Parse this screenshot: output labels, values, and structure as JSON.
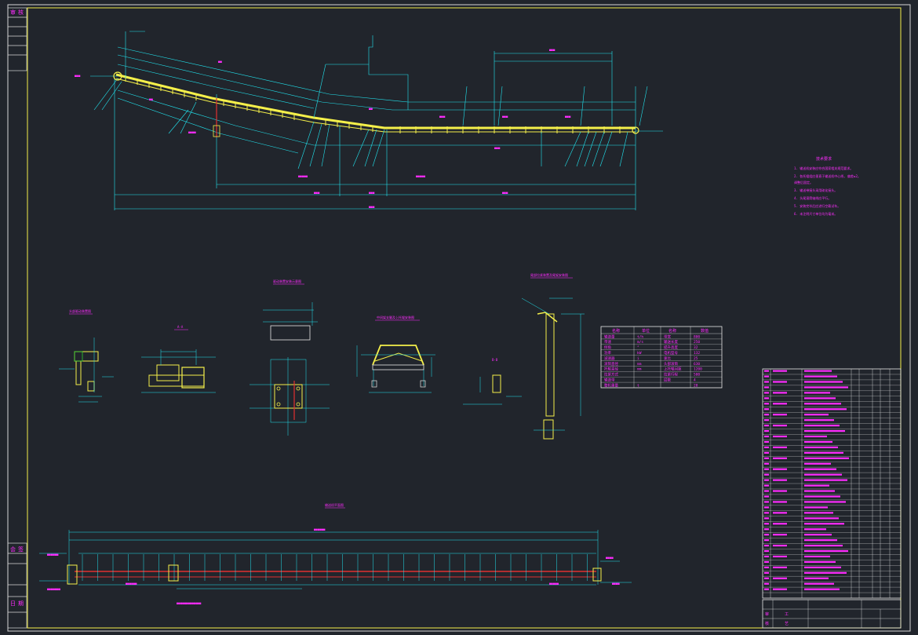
{
  "drawing": {
    "background": "#21252c",
    "colors": {
      "frame": "#f5f04a",
      "dimension": "#22e5f0",
      "label": "#ff2cff",
      "belt": "#f5f04a",
      "idler_line": "#e03030",
      "border": "#d8d8d8"
    },
    "title_block": {
      "left_top_chars": [
        "审",
        "核"
      ],
      "left_bottom_chars": [
        "会",
        "签"
      ],
      "left_footer_chars": [
        "日",
        "期"
      ],
      "bottom_right_chars": [
        "审",
        "核",
        "工",
        "艺"
      ]
    },
    "views": [
      {
        "label": "输送机布置图"
      },
      {
        "label": "头部驱动装置图"
      },
      {
        "label": "A-A"
      },
      {
        "label": "驱动装置安装示意图"
      },
      {
        "label": "中间架支腿及上托辊安装图"
      },
      {
        "label": "B-B"
      },
      {
        "label": "尾部拉紧装置及尾架安装图"
      },
      {
        "label": "输送机平面图"
      }
    ],
    "notes": {
      "heading": "技术要求",
      "items": [
        "1. 输送机安装应符合国家相关规范要求。",
        "2. 各托辊组应垂直于输送机中心线, 偏差≤2。",
        "   调整后固定。",
        "3. 输送带接头采用硫化接头。",
        "4. 头尾滚筒轴线应平行。",
        "5. 安装完毕后应进行空载试车。",
        "6. 未注明尺寸单位均为毫米。"
      ]
    },
    "param_table": {
      "headers": [
        "名称",
        "单位",
        "名称",
        "数值"
      ],
      "rows": [
        [
          "输送量",
          "t/h",
          "带宽",
          "800"
        ],
        [
          "带速",
          "m/s",
          "输送长度",
          "250"
        ],
        [
          "倾角",
          "°",
          "提升高度",
          "32"
        ],
        [
          "功率",
          "kW",
          "电机型号",
          "132"
        ],
        [
          "减速器",
          "i",
          "速比",
          "25"
        ],
        [
          "滚筒直径",
          "mm",
          "头部滚筒",
          "630"
        ],
        [
          "托辊直径",
          "mm",
          "上托辊间距",
          "1200"
        ],
        [
          "拉紧方式",
          "",
          "拉紧行程",
          "500"
        ],
        [
          "输送带",
          "",
          "层数",
          "4"
        ],
        [
          "整机重量",
          "t",
          "",
          "28"
        ]
      ]
    },
    "parts_list": {
      "rows": 42
    }
  }
}
